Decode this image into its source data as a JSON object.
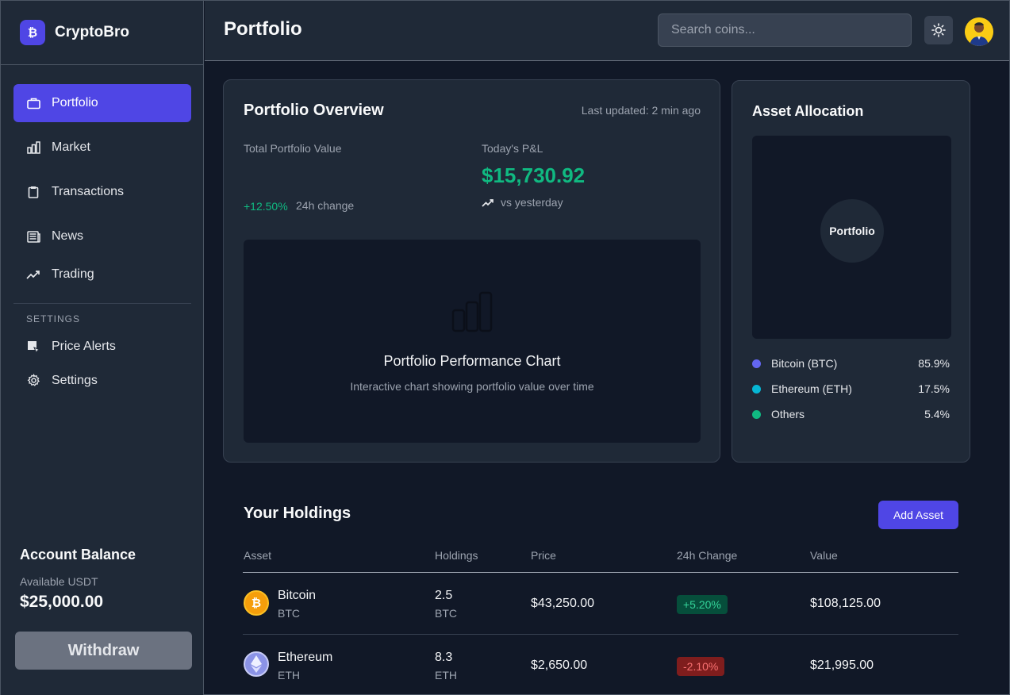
{
  "brand": {
    "logo_letter": "₿",
    "name": "CryptoBro"
  },
  "sidebar": {
    "items": [
      {
        "label": "Portfolio",
        "icon": "briefcase-icon",
        "active": true
      },
      {
        "label": "Market",
        "icon": "bar-chart-icon"
      },
      {
        "label": "Transactions",
        "icon": "clipboard-icon"
      },
      {
        "label": "News",
        "icon": "newspaper-icon"
      },
      {
        "label": "Trading",
        "icon": "trending-up-icon"
      }
    ],
    "settings_section": "SETTINGS",
    "settings_items": [
      {
        "label": "Price Alerts",
        "icon": "alert-icon"
      },
      {
        "label": "Settings",
        "icon": "gear-icon"
      }
    ],
    "balance": {
      "title": "Account Balance",
      "subtitle": "Available USDT",
      "amount": "$25,000.00"
    },
    "withdraw_label": "Withdraw"
  },
  "header": {
    "title": "Portfolio",
    "search_placeholder": "Search coins..."
  },
  "overview": {
    "title": "Portfolio Overview",
    "updated": "Last updated: 2 min ago",
    "total_label": "Total Portfolio Value",
    "change_pct": "+12.50%",
    "change_label": "24h change",
    "pnl_label": "Today's P&L",
    "pnl_value": "$15,730.92",
    "vs_label": "vs yesterday",
    "chart_title": "Portfolio Performance Chart",
    "chart_subtitle": "Interactive chart showing portfolio value over time"
  },
  "allocation": {
    "title": "Asset Allocation",
    "center_label": "Portfolio",
    "items": [
      {
        "name": "Bitcoin (BTC)",
        "value": "85.9%",
        "color": "#6366f1"
      },
      {
        "name": "Ethereum (ETH)",
        "value": "17.5%",
        "color": "#06b6d4"
      },
      {
        "name": "Others",
        "value": "5.4%",
        "color": "#10b981"
      }
    ]
  },
  "holdings": {
    "title": "Your Holdings",
    "add_label": "Add Asset",
    "columns": [
      "Asset",
      "Holdings",
      "Price",
      "24h Change",
      "Value"
    ],
    "rows": [
      {
        "name": "Bitcoin",
        "symbol": "BTC",
        "amount": "2.5",
        "price": "$43,250.00",
        "change": "+5.20%",
        "direction": "up",
        "value": "$108,125.00",
        "icon": "bitcoin-icon"
      },
      {
        "name": "Ethereum",
        "symbol": "ETH",
        "amount": "8.3",
        "price": "$2,650.00",
        "change": "-2.10%",
        "direction": "down",
        "value": "$21,995.00",
        "icon": "ethereum-icon"
      }
    ]
  },
  "colors": {
    "accent": "#4f46e5",
    "positive": "#10b981",
    "negative": "#f87171",
    "background": "#111827",
    "surface": "#1f2937"
  }
}
